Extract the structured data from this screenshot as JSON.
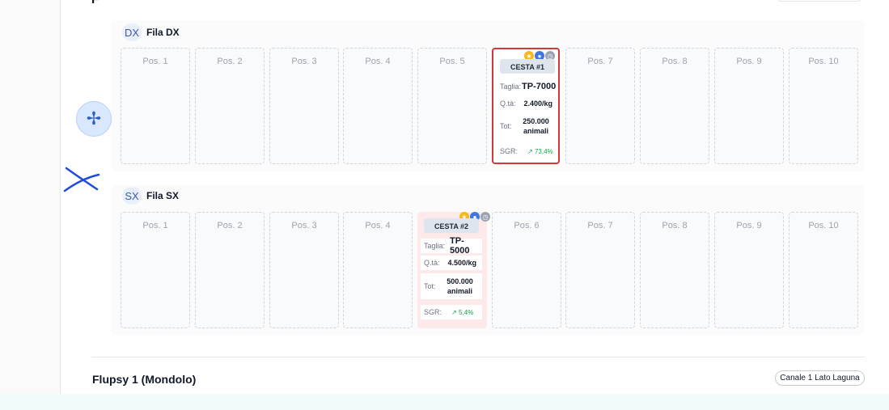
{
  "top": {
    "title_fragment": "F"
  },
  "rows": [
    {
      "badge": "DX",
      "label": "Fila DX",
      "slots": [
        "Pos. 1",
        "Pos. 2",
        "Pos. 3",
        "Pos. 4",
        "Pos. 5",
        "",
        "Pos. 7",
        "Pos. 8",
        "Pos. 9",
        "Pos. 10"
      ],
      "basket": {
        "position_index": 6,
        "title": "CESTA #1",
        "taglia_label": "Taglia:",
        "taglia_value": "TP-7000",
        "qta_label": "Q.tà:",
        "qta_value": "2.400/kg",
        "tot_label": "Tot:",
        "tot_value": "250.000 animali",
        "sgr_label": "SGR:",
        "sgr_value": "↗ 73,4%",
        "selected": true
      }
    },
    {
      "badge": "SX",
      "label": "Fila SX",
      "slots": [
        "Pos. 1",
        "Pos. 2",
        "Pos. 3",
        "Pos. 4",
        "",
        "Pos. 6",
        "Pos. 7",
        "Pos. 8",
        "Pos. 9",
        "Pos. 10"
      ],
      "basket": {
        "position_index": 5,
        "title": "CESTA #2",
        "taglia_label": "Taglia:",
        "taglia_value": "TP-5000",
        "qta_label": "Q.tà:",
        "qta_value": "4.500/kg",
        "tot_label": "Tot:",
        "tot_value": "500.000 animali",
        "sgr_label": "SGR:",
        "sgr_value": "↗ 5,4%",
        "selected": false
      }
    }
  ],
  "flupsy": {
    "title": "Flupsy 1 (Mondolo)",
    "channel_chip": "Canale 1 Lato Laguna"
  },
  "icons": {
    "floating": "settings-fan-icon",
    "scribble": "close-cross-icon"
  },
  "colors": {
    "selected_border": "#d63838",
    "row_badge": "#3b5ba9",
    "sgr_up": "#16a34a",
    "star": "#f5b81f",
    "team": "#3f76e0"
  }
}
